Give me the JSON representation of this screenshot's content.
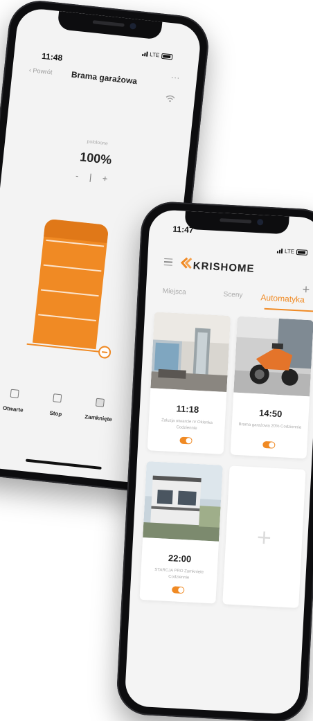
{
  "left_phone": {
    "status_time": "11:48",
    "status_network": "LTE",
    "back_label": "Powrót",
    "title": "Brama garażowa",
    "more_menu": "...",
    "level_label": "pololoone",
    "level_value": "100%",
    "level_controls": "- | +",
    "buttons": [
      {
        "label": "Otwarte",
        "icon": "open-icon"
      },
      {
        "label": "Stop",
        "icon": "stop-icon"
      },
      {
        "label": "Zamknięte",
        "icon": "close-icon"
      }
    ],
    "accent": "#f08a24"
  },
  "right_phone": {
    "status_time": "11:47",
    "status_network": "LTE",
    "brand": "KRISHOME",
    "tabs": [
      "Miejsca",
      "Sceny",
      "Automatyka"
    ],
    "active_tab": "Automatyka",
    "cards": [
      {
        "time": "11:18",
        "description": "Żaluzja otwarcie nr Okienka Codziennie",
        "enabled": true,
        "photo": "room-interior"
      },
      {
        "time": "14:50",
        "description": "Brama garażowa 20% Codziennie",
        "enabled": true,
        "photo": "garage-motorcycle"
      },
      {
        "time": "22:00",
        "description": "STARCJA PRO Zamknięte Codziennie",
        "enabled": true,
        "photo": "house-exterior"
      }
    ],
    "add_card": "+",
    "accent": "#f08a24"
  }
}
